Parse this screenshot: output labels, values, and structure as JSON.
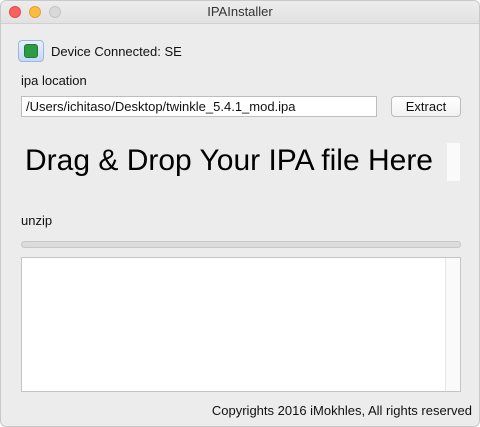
{
  "window": {
    "title": "IPAInstaller"
  },
  "device": {
    "status_icon": "green-status-indicator-icon",
    "status_color": "#2e9a46",
    "status_text": "Device Connected: SE"
  },
  "ipa": {
    "label": "ipa location",
    "path_value": "/Users/ichitaso/Desktop/twinkle_5.4.1_mod.ipa",
    "extract_label": "Extract"
  },
  "drop_zone": {
    "text": "Drag & Drop Your IPA file Here"
  },
  "unzip": {
    "label": "unzip",
    "progress": 0
  },
  "log": {
    "content": ""
  },
  "footer": {
    "copyright": "Copyrights 2016 iMokhles, All rights reserved"
  }
}
